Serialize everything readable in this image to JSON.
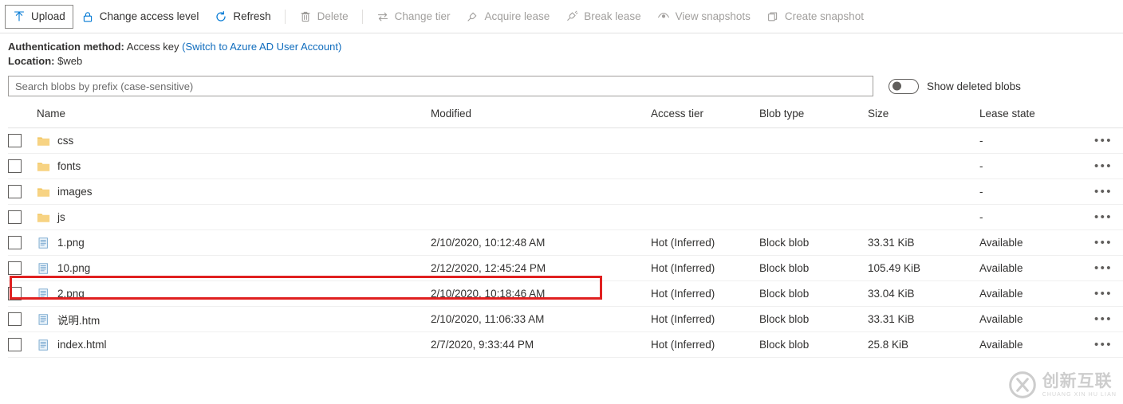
{
  "toolbar": {
    "items": [
      {
        "label": "Upload",
        "icon": "upload-icon",
        "state": "focused"
      },
      {
        "label": "Change access level",
        "icon": "lock-icon",
        "state": "enabled"
      },
      {
        "label": "Refresh",
        "icon": "refresh-icon",
        "state": "enabled"
      },
      {
        "label": "Delete",
        "icon": "trash-icon",
        "state": "disabled"
      },
      {
        "label": "Change tier",
        "icon": "swap-icon",
        "state": "disabled"
      },
      {
        "label": "Acquire lease",
        "icon": "plug-icon",
        "state": "disabled"
      },
      {
        "label": "Break lease",
        "icon": "unplug-icon",
        "state": "disabled"
      },
      {
        "label": "View snapshots",
        "icon": "eye-icon",
        "state": "disabled"
      },
      {
        "label": "Create snapshot",
        "icon": "copy-icon",
        "state": "disabled"
      }
    ]
  },
  "info": {
    "auth_label": "Authentication method:",
    "auth_value": "Access key",
    "auth_link": "(Switch to Azure AD User Account)",
    "location_label": "Location:",
    "location_value": "$web"
  },
  "search": {
    "placeholder": "Search blobs by prefix (case-sensitive)",
    "value": "",
    "toggle_label": "Show deleted blobs",
    "toggle_on": false
  },
  "table": {
    "columns": [
      "Name",
      "Modified",
      "Access tier",
      "Blob type",
      "Size",
      "Lease state"
    ],
    "rows": [
      {
        "name": "css",
        "icon": "folder-icon",
        "modified": "",
        "tier": "",
        "type": "",
        "size": "",
        "lease": "-",
        "menu": "•••",
        "highlighted": false
      },
      {
        "name": "fonts",
        "icon": "folder-icon",
        "modified": "",
        "tier": "",
        "type": "",
        "size": "",
        "lease": "-",
        "menu": "•••",
        "highlighted": false
      },
      {
        "name": "images",
        "icon": "folder-icon",
        "modified": "",
        "tier": "",
        "type": "",
        "size": "",
        "lease": "-",
        "menu": "•••",
        "highlighted": false
      },
      {
        "name": "js",
        "icon": "folder-icon",
        "modified": "",
        "tier": "",
        "type": "",
        "size": "",
        "lease": "-",
        "menu": "•••",
        "highlighted": false
      },
      {
        "name": "1.png",
        "icon": "document-icon",
        "modified": "2/10/2020, 10:12:48 AM",
        "tier": "Hot (Inferred)",
        "type": "Block blob",
        "size": "33.31 KiB",
        "lease": "Available",
        "menu": "•••",
        "highlighted": false
      },
      {
        "name": "10.png",
        "icon": "document-icon",
        "modified": "2/12/2020, 12:45:24 PM",
        "tier": "Hot (Inferred)",
        "type": "Block blob",
        "size": "105.49 KiB",
        "lease": "Available",
        "menu": "•••",
        "highlighted": true
      },
      {
        "name": "2.png",
        "icon": "document-icon",
        "modified": "2/10/2020, 10:18:46 AM",
        "tier": "Hot (Inferred)",
        "type": "Block blob",
        "size": "33.04 KiB",
        "lease": "Available",
        "menu": "•••",
        "highlighted": false
      },
      {
        "name": "说明.htm",
        "icon": "document-icon",
        "modified": "2/10/2020, 11:06:33 AM",
        "tier": "Hot (Inferred)",
        "type": "Block blob",
        "size": "33.31 KiB",
        "lease": "Available",
        "menu": "•••",
        "highlighted": false
      },
      {
        "name": "index.html",
        "icon": "document-icon",
        "modified": "2/7/2020, 9:33:44 PM",
        "tier": "Hot (Inferred)",
        "type": "Block blob",
        "size": "25.8 KiB",
        "lease": "Available",
        "menu": "•••",
        "highlighted": false
      }
    ]
  },
  "watermark": {
    "chinese": "创新互联",
    "pinyin": "CHUANG XIN HU LIAN"
  },
  "colors": {
    "link": "#0f6cbd",
    "accent": "#0078d4",
    "folder": "#f2c661",
    "highlight": "#e02020",
    "disabled_text": "#a19f9d"
  }
}
